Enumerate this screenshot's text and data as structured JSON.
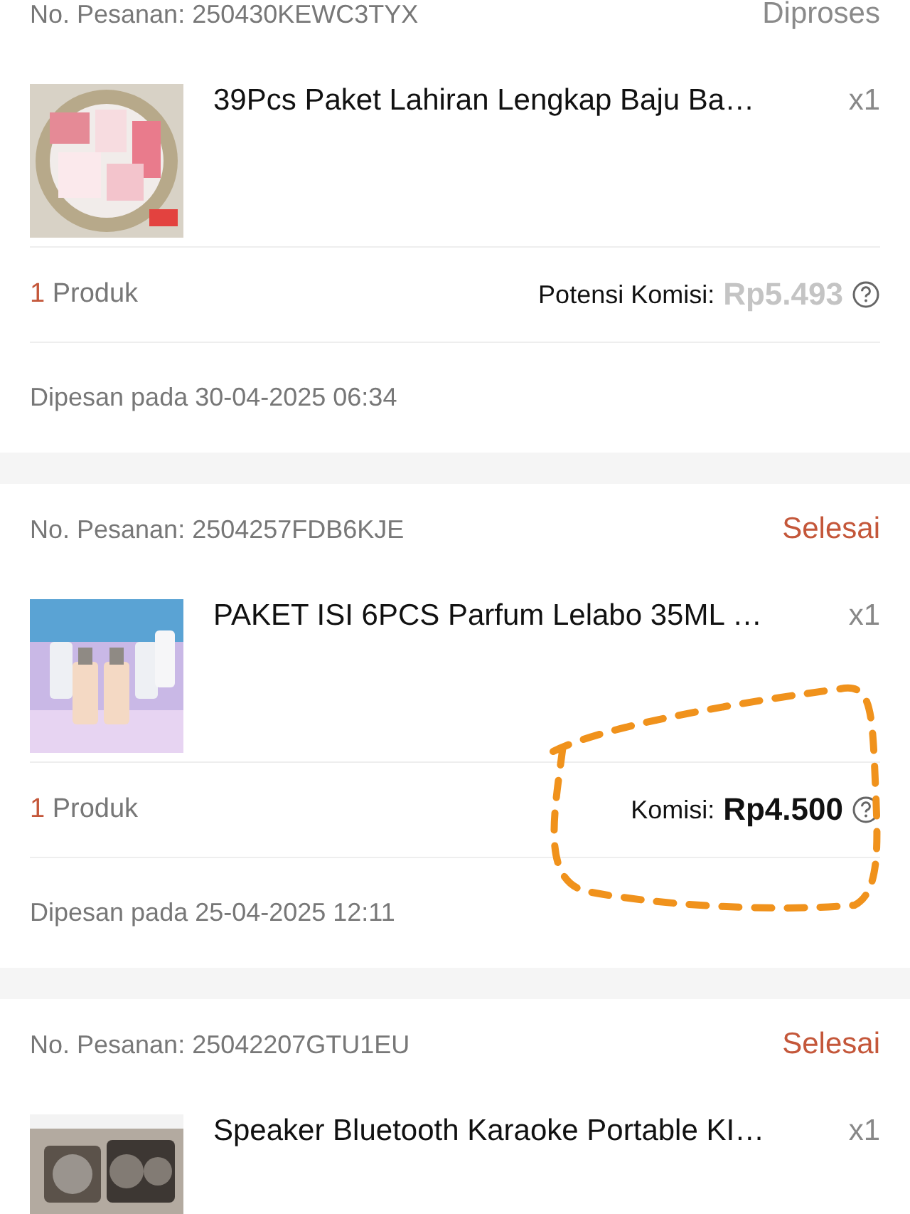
{
  "orders": [
    {
      "order_label": "No. Pesanan: 250430KEWC3TYX",
      "status": {
        "text": "Diproses",
        "kind": "processing"
      },
      "product": {
        "title": "39Pcs Paket Lahiran Lengkap Baju Ba…",
        "quantity": "x1"
      },
      "count": "1",
      "count_label": "Produk",
      "commission": {
        "kind": "potential",
        "label": "Potensi Komisi:",
        "value": "Rp5.493"
      },
      "ordered_at": "Dipesan pada 30-04-2025 06:34",
      "highlighted": false
    },
    {
      "order_label": "No. Pesanan: 2504257FDB6KJE",
      "status": {
        "text": "Selesai",
        "kind": "done"
      },
      "product": {
        "title": "PAKET ISI 6PCS Parfum Lelabo 35ML …",
        "quantity": "x1"
      },
      "count": "1",
      "count_label": "Produk",
      "commission": {
        "kind": "final",
        "label": "Komisi:",
        "value": "Rp4.500"
      },
      "ordered_at": "Dipesan pada 25-04-2025 12:11",
      "highlighted": true
    },
    {
      "order_label": "No. Pesanan: 25042207GTU1EU",
      "status": {
        "text": "Selesai",
        "kind": "done"
      },
      "product": {
        "title": "Speaker Bluetooth Karaoke Portable KI…",
        "quantity": "x1"
      }
    }
  ]
}
